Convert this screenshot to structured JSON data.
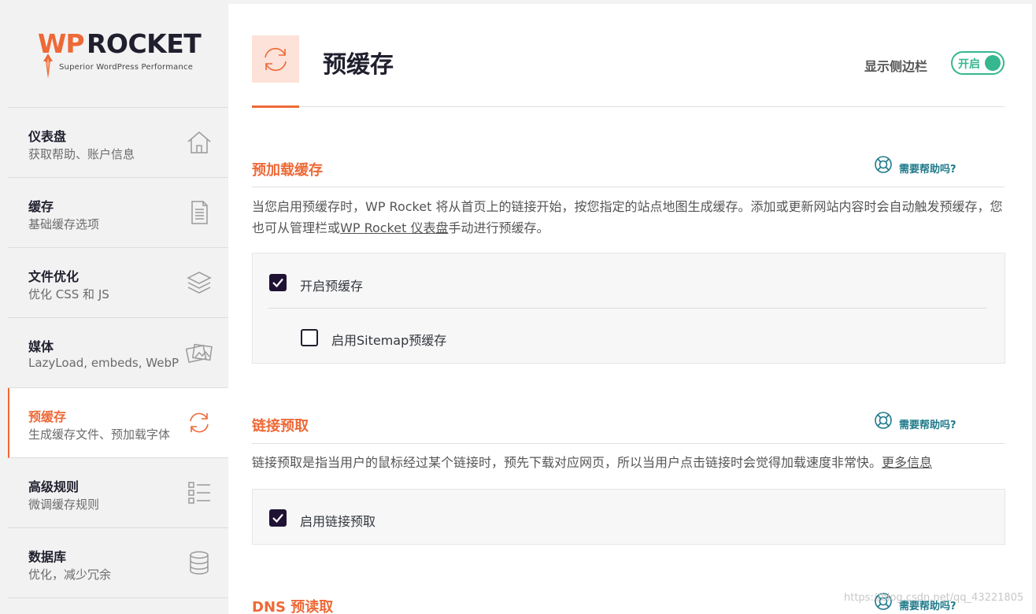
{
  "brand": {
    "wp": "WP",
    "rocket": "ROCKET",
    "tagline": "Superior WordPress Performance",
    "accent_color": "#ed6937"
  },
  "sidebar": {
    "items": [
      {
        "title": "仪表盘",
        "sub": "获取帮助、账户信息",
        "icon": "home-icon"
      },
      {
        "title": "缓存",
        "sub": "基础缓存选项",
        "icon": "file-icon"
      },
      {
        "title": "文件优化",
        "sub": "优化 CSS 和 JS",
        "icon": "layers-icon"
      },
      {
        "title": "媒体",
        "sub": "LazyLoad, embeds, WebP",
        "icon": "images-icon"
      },
      {
        "title": "预缓存",
        "sub": "生成缓存文件、预加载字体",
        "icon": "refresh-icon",
        "active": true
      },
      {
        "title": "高级规则",
        "sub": "微调缓存规则",
        "icon": "rules-list-icon"
      },
      {
        "title": "数据库",
        "sub": "优化，减少冗余",
        "icon": "database-icon"
      }
    ]
  },
  "header": {
    "title": "预缓存",
    "sidebar_toggle_label": "显示侧边栏",
    "toggle_text": "开启"
  },
  "sections": {
    "preload": {
      "title": "预加载缓存",
      "help": "需要帮助吗?",
      "desc_1": "当您启用预缓存时，WP Rocket 将从首页上的链接开始，按您指定的站点地图生成缓存。添加或更新网站内容时会自动触发预缓存，您也可从管理栏或",
      "desc_link": "WP Rocket 仪表盘",
      "desc_2": "手动进行预缓存。",
      "opt_enable": "开启预缓存",
      "opt_sitemap": "启用Sitemap预缓存"
    },
    "prefetch": {
      "title": "链接预取",
      "help": "需要帮助吗?",
      "desc": "链接预取是指当用户的鼠标经过某个链接时，预先下载对应网页，所以当用户点击链接时会觉得加载速度非常快。",
      "desc_link": "更多信息",
      "opt_enable": "启用链接预取"
    },
    "dns": {
      "title": "DNS 预读取",
      "help": "需要帮助吗?"
    }
  },
  "watermark": "https://blog.csdn.net/qq_43221805",
  "colors": {
    "toggle_on": "#35b78f",
    "help": "#1e7a8a",
    "checkbox_checked": "#1f1233"
  }
}
